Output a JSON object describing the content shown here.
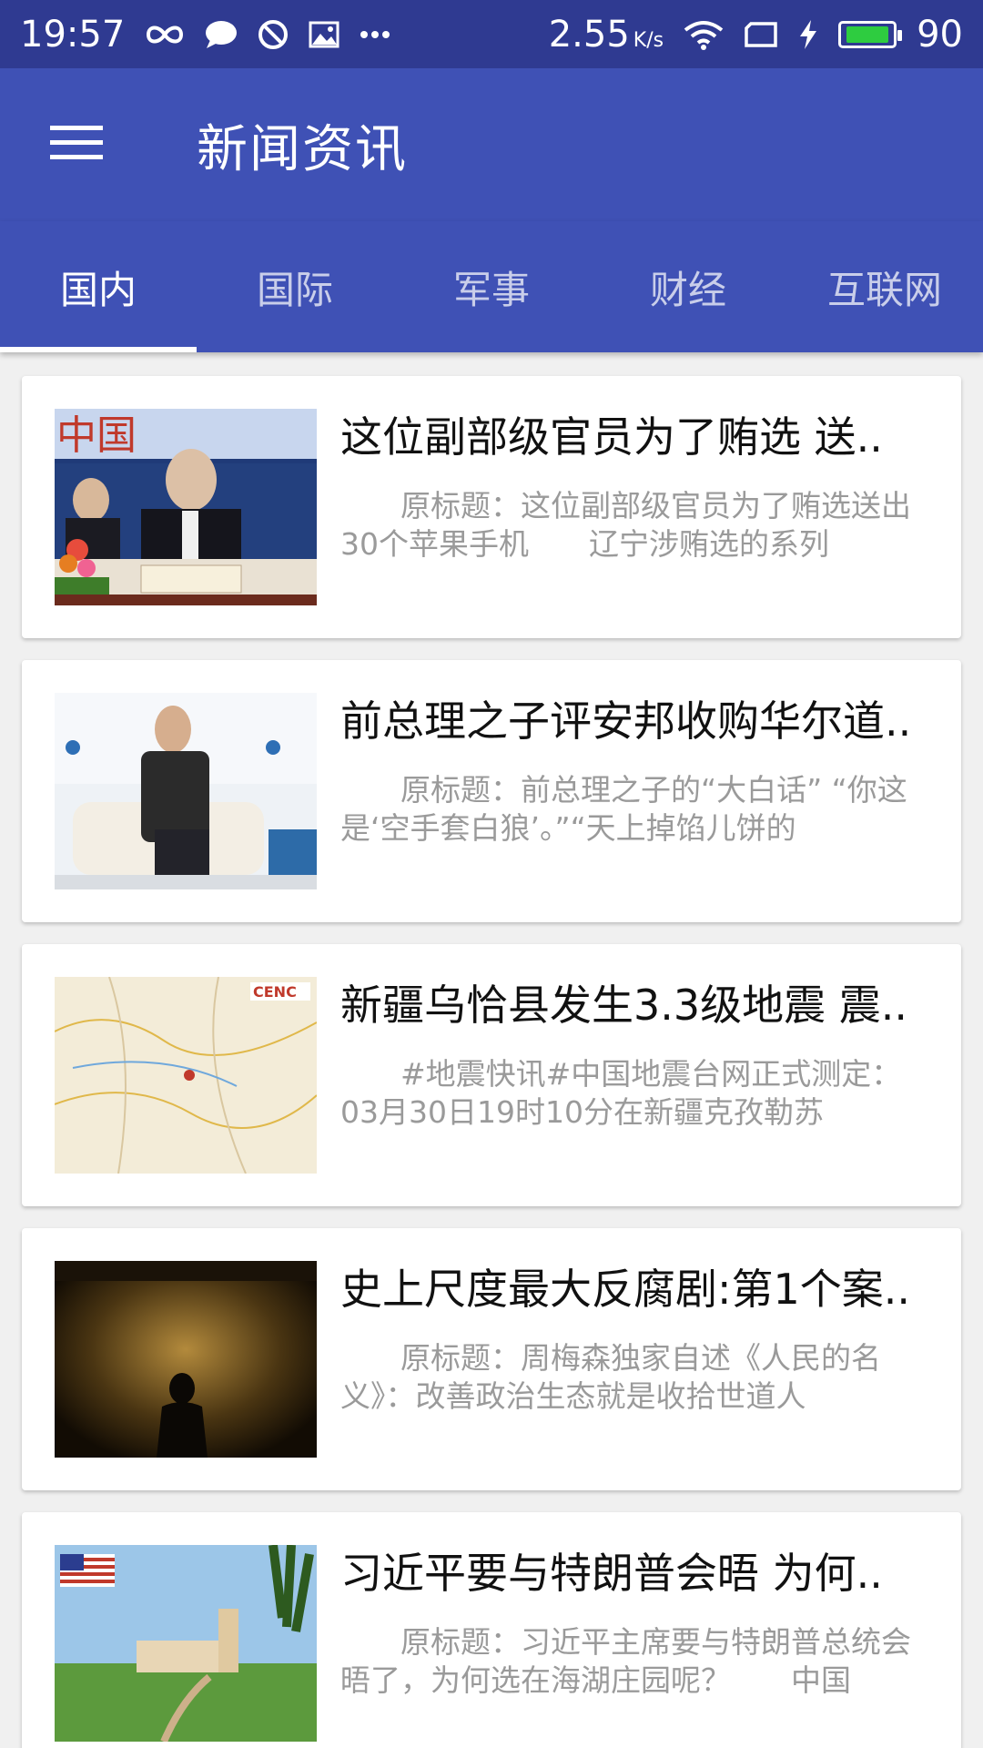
{
  "status_bar": {
    "time": "19:57",
    "speed": "2.55",
    "speed_unit": "K/s",
    "battery": "90",
    "battery_level_percent": 90,
    "icons": [
      "infinity-icon",
      "chat-bubble-icon",
      "no-disturb-icon",
      "image-icon",
      "more-dots-icon",
      "wifi-icon",
      "screen-icon",
      "charging-icon",
      "battery-icon"
    ],
    "colors": {
      "background": "#2f3a91",
      "battery_fill": "#2ecc40"
    }
  },
  "app_bar": {
    "title": "新闻资讯",
    "menu_icon": "hamburger-menu-icon",
    "background": "#3f51b5"
  },
  "tabs": [
    {
      "label": "国内",
      "active": true
    },
    {
      "label": "国际",
      "active": false
    },
    {
      "label": "军事",
      "active": false
    },
    {
      "label": "财经",
      "active": false
    },
    {
      "label": "互联网",
      "active": false
    }
  ],
  "news": [
    {
      "title": "这位副部级官员为了贿选 送..",
      "summary": "原标题：这位副部级官员为了贿选送出30个苹果手机　　辽宁涉贿选的系列",
      "image": "press-conference-photo"
    },
    {
      "title": "前总理之子评安邦收购华尔道..",
      "summary": "原标题：前总理之子的“大白话” “你这是‘空手套白狼’。”“天上掉馅儿饼的",
      "image": "forum-speaker-photo"
    },
    {
      "title": "新疆乌恰县发生3.3级地震 震..",
      "summary": "#地震快讯#中国地震台网正式测定：03月30日19时10分在新疆克孜勒苏",
      "image": "earthquake-map-image"
    },
    {
      "title": "史上尺度最大反腐剧:第1个案..",
      "summary": "原标题：周梅森独家自述《人民的名义》：改善政治生态就是收拾世道人",
      "image": "tv-drama-poster"
    },
    {
      "title": "习近平要与特朗普会晤 为何..",
      "summary": "原标题：习近平主席要与特朗普总统会晤了，为何选在海湖庄园呢？　　中国",
      "image": "resort-photo"
    }
  ]
}
